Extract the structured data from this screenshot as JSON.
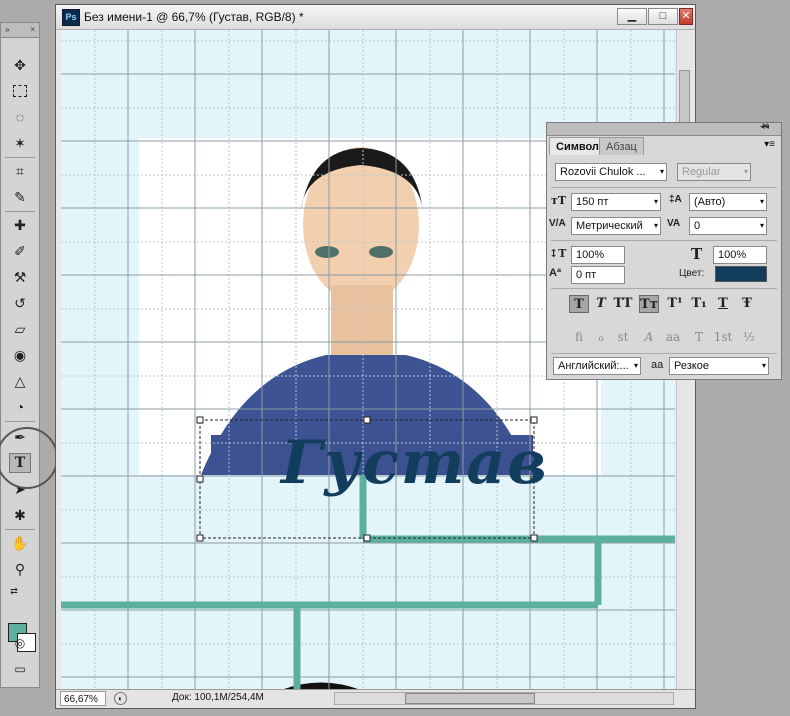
{
  "document": {
    "title": "Без имени-1 @ 66,7% (Густав, RGB/8) *",
    "app_icon": "Ps",
    "text_layer": "Густав",
    "zoom": "66,67%",
    "doc_size": "Док: 100,1M/254,4M"
  },
  "window_buttons": {
    "minimize": "▁",
    "maximize": "□",
    "close": "✕"
  },
  "toolbox": {
    "header": "»",
    "close": "×",
    "tools": [
      "move-icon",
      "marquee-icon",
      "lasso-icon",
      "magic-wand-icon",
      "crop-icon",
      "eyedropper-icon",
      "healing-brush-icon",
      "brush-icon",
      "clone-stamp-icon",
      "history-brush-icon",
      "eraser-icon",
      "paint-bucket-icon",
      "blur-icon",
      "dodge-icon",
      "pen-icon",
      "type-icon",
      "path-selection-icon",
      "shape-icon",
      "hand-icon",
      "zoom-icon"
    ],
    "active_tool": "type-icon",
    "foreground_color": "#5bb0a0",
    "background_color": "#ffffff"
  },
  "character_panel": {
    "collapse": "◂◂",
    "close": "✕",
    "tabs": [
      "Символ",
      "Абзац"
    ],
    "active_tab": "Символ",
    "font_family": "Rozovii Chulok ...",
    "font_style": "Regular",
    "font_size": "150 пт",
    "leading": "(Авто)",
    "kerning": "Метрический",
    "tracking": "0",
    "vertical_scale": "100%",
    "horizontal_scale": "100%",
    "baseline_shift": "0 пт",
    "color_label": "Цвет:",
    "color": "#123d5c",
    "language": "Английский:...",
    "aa_label": "aa",
    "antialias": "Резкое",
    "type_buttons": [
      "T",
      "T",
      "TT",
      "Tт",
      "T¹",
      "T₁",
      "T",
      "Ŧ"
    ],
    "opentype_buttons": [
      "fi",
      "ℴ",
      "st",
      "A",
      "aa",
      "T",
      "1st",
      "½"
    ]
  }
}
